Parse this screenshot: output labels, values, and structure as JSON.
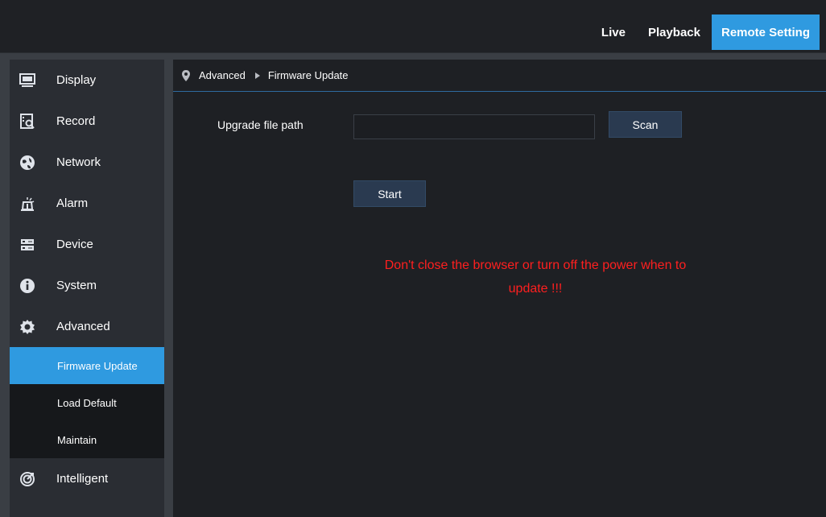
{
  "topnav": {
    "tabs": [
      {
        "label": "Live"
      },
      {
        "label": "Playback"
      },
      {
        "label": "Remote Setting"
      }
    ]
  },
  "sidebar": {
    "items": [
      {
        "label": "Display",
        "icon": "monitor-icon"
      },
      {
        "label": "Record",
        "icon": "record-icon"
      },
      {
        "label": "Network",
        "icon": "network-icon"
      },
      {
        "label": "Alarm",
        "icon": "alarm-icon"
      },
      {
        "label": "Device",
        "icon": "device-icon"
      },
      {
        "label": "System",
        "icon": "info-icon"
      },
      {
        "label": "Advanced",
        "icon": "gear-icon"
      }
    ],
    "subitems": [
      {
        "label": "Firmware Update"
      },
      {
        "label": "Load Default"
      },
      {
        "label": "Maintain"
      }
    ],
    "last_item": {
      "label": "Intelligent",
      "icon": "intelligent-icon"
    }
  },
  "breadcrumb": {
    "section": "Advanced",
    "page": "Firmware Update"
  },
  "form": {
    "path_label": "Upgrade file path",
    "path_value": "",
    "scan_label": "Scan",
    "start_label": "Start"
  },
  "warning_line1": "Don't close the browser or turn off the power when to",
  "warning_line2": "update !!!",
  "colors": {
    "accent": "#2f9ae0",
    "warning": "#ff1f1f",
    "button": "#2a3a50"
  }
}
